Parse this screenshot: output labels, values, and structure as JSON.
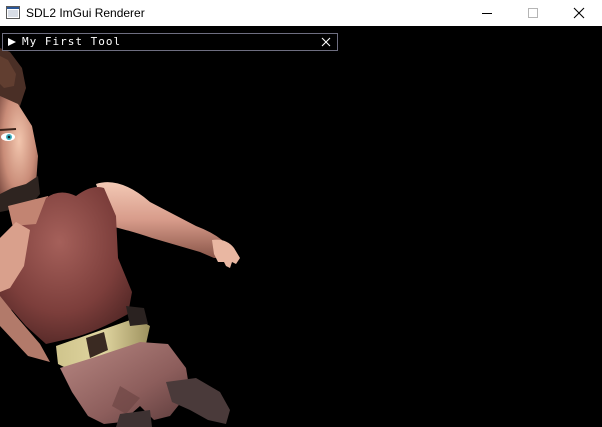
{
  "window": {
    "title": "SDL2 ImGui Renderer",
    "icons": {
      "app": "window-app-icon",
      "minimize": "minimize-icon",
      "maximize": "maximize-icon",
      "close": "close-icon"
    }
  },
  "imgui": {
    "tool_window": {
      "title": "My First Tool",
      "state": "collapsed",
      "icons": {
        "collapse": "triangle-right-icon",
        "close": "close-x-icon"
      }
    }
  },
  "scene": {
    "description_name": "3d-character-model",
    "background_color": "#000000"
  },
  "colors": {
    "titlebar_bg": "#ffffff",
    "imgui_border": "#6e6e80",
    "imgui_text": "#ffffff"
  }
}
